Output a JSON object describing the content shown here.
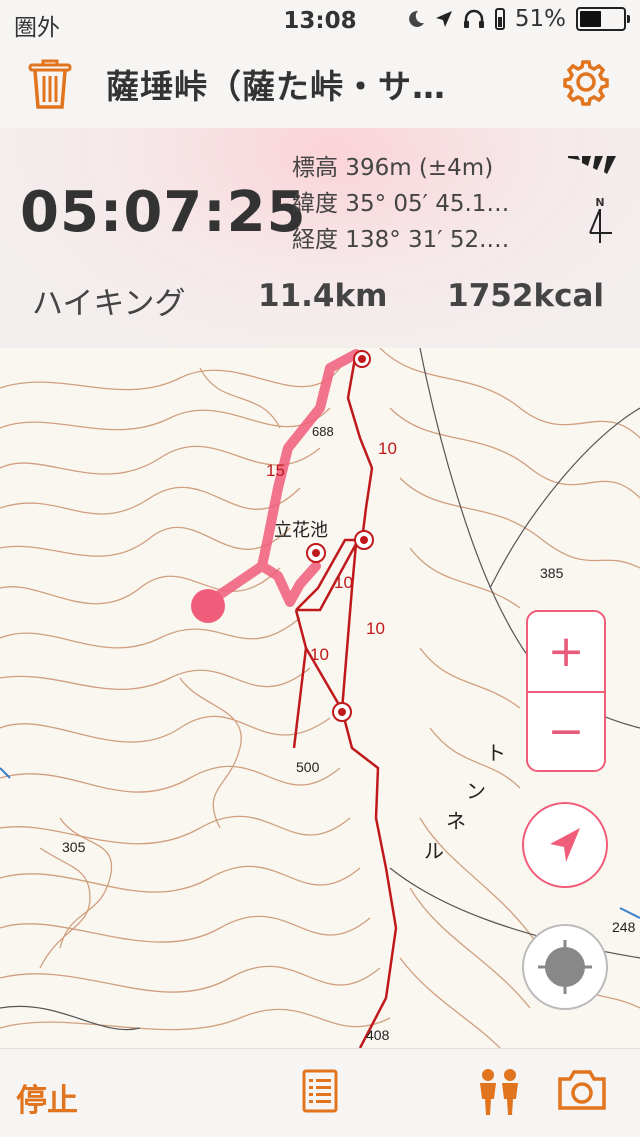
{
  "status_bar": {
    "carrier": "圏外",
    "time": "13:08",
    "battery": "51%",
    "battery_level": 0.51
  },
  "nav": {
    "title": "薩埵峠（薩た峠・サ…"
  },
  "info": {
    "elapsed": "05:07:25",
    "elevation": "標高 396m (±4m)",
    "latitude": "緯度 35° 05′ 45.1…",
    "longitude": "経度 138° 31′ 52.…",
    "compass_letter": "N",
    "mode": "ハイキング",
    "distance": "11.4km",
    "calories": "1752kcal"
  },
  "map": {
    "place_label": "立花池",
    "labels": [
      "10",
      "10",
      "10",
      "10",
      "15",
      "385",
      "500",
      "305",
      "248",
      "408",
      "688",
      "ト",
      "ン",
      "ネ",
      "ル"
    ],
    "zoom_in": "+",
    "zoom_out": "−",
    "accent_color": "#f05d7a",
    "route_color": "#c0191c",
    "contour_color": "#c9906b"
  },
  "toolbar": {
    "stop_label": "停止"
  },
  "icons": {
    "trash": "trash-icon",
    "gear": "gear-icon",
    "signal": "signal-icon",
    "compass": "compass-icon",
    "location": "location-arrow-icon",
    "tracking": "tracking-icon",
    "list": "list-icon",
    "people": "people-icon",
    "camera": "camera-icon"
  }
}
